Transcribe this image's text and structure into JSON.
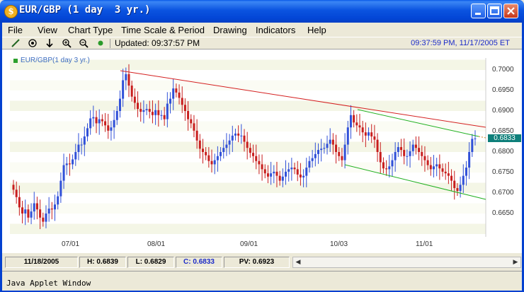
{
  "window": {
    "title": "EUR/GBP (1 day  3 yr.)",
    "app_icon": "gold-coin-icon"
  },
  "menu": [
    "File",
    "View",
    "Chart Type",
    "Time Scale & Period",
    "Drawing",
    "Indicators",
    "Help"
  ],
  "toolbar": {
    "icons": [
      "line-draw-icon",
      "crosshair-icon",
      "down-arrow-icon",
      "zoom-in-icon",
      "zoom-out-icon",
      "green-dot-icon"
    ],
    "updated": "Updated: 09:37:57 PM",
    "clock": "09:37:59 PM, 11/17/2005 ET"
  },
  "chart": {
    "legend_label": "EUR/GBP(1 day 3 yr.)",
    "last_price": "0.6833"
  },
  "status": {
    "date": "11/18/2005",
    "high": "H: 0.6839",
    "low": "L: 0.6829",
    "close": "C: 0.6833",
    "pv": "PV: 0.6923"
  },
  "footer": "Java Applet Window",
  "chart_data": {
    "type": "candlestick",
    "series_name": "EUR/GBP(1 day 3 yr.)",
    "y_ticks": [
      "0.7000",
      "0.6950",
      "0.6900",
      "0.6850",
      "0.6800",
      "0.6750",
      "0.6700",
      "0.6650"
    ],
    "x_ticks": [
      "07/01",
      "08/01",
      "09/01",
      "10/03",
      "11/01"
    ],
    "ylim": [
      0.661,
      0.703
    ],
    "up_color": "#3050d8",
    "down_color": "#c81e1e",
    "closes": [
      0.6708,
      0.669,
      0.6665,
      0.665,
      0.666,
      0.664,
      0.6655,
      0.6675,
      0.666,
      0.664,
      0.663,
      0.665,
      0.6662,
      0.666,
      0.6672,
      0.6692,
      0.673,
      0.6768,
      0.6772,
      0.677,
      0.6782,
      0.68,
      0.6818,
      0.6818,
      0.6838,
      0.6858,
      0.6882,
      0.6885,
      0.687,
      0.688,
      0.6875,
      0.6865,
      0.6852,
      0.686,
      0.6878,
      0.69,
      0.693,
      0.6975,
      0.699,
      0.6962,
      0.6935,
      0.692,
      0.6905,
      0.6898,
      0.6902,
      0.6905,
      0.6898,
      0.689,
      0.6902,
      0.689,
      0.689,
      0.688,
      0.6918,
      0.693,
      0.6955,
      0.6945,
      0.6932,
      0.6915,
      0.69,
      0.688,
      0.687,
      0.6852,
      0.6828,
      0.6808,
      0.68,
      0.6792,
      0.6778,
      0.677,
      0.678,
      0.679,
      0.68,
      0.681,
      0.6818,
      0.6828,
      0.684,
      0.6845,
      0.684,
      0.684,
      0.6825,
      0.681,
      0.6798,
      0.679,
      0.6778,
      0.677,
      0.6758,
      0.6748,
      0.674,
      0.6748,
      0.6752,
      0.6742,
      0.673,
      0.674,
      0.6752,
      0.6758,
      0.6762,
      0.6758,
      0.6745,
      0.6738,
      0.6742,
      0.6762,
      0.6778,
      0.6785,
      0.6795,
      0.6805,
      0.6808,
      0.681,
      0.682,
      0.683,
      0.6818,
      0.68,
      0.679,
      0.678,
      0.6818,
      0.686,
      0.689,
      0.6872,
      0.6865,
      0.686,
      0.6848,
      0.684,
      0.6848,
      0.6838,
      0.683,
      0.68,
      0.6775,
      0.676,
      0.6758,
      0.6765,
      0.678,
      0.68,
      0.6812,
      0.6805,
      0.679,
      0.679,
      0.6802,
      0.6818,
      0.681,
      0.68,
      0.679,
      0.678,
      0.6768,
      0.6758,
      0.6765,
      0.677,
      0.676,
      0.6752,
      0.6748,
      0.6742,
      0.673,
      0.6712,
      0.6705,
      0.672,
      0.6742,
      0.6762,
      0.68,
      0.6832,
      0.6833
    ]
  }
}
